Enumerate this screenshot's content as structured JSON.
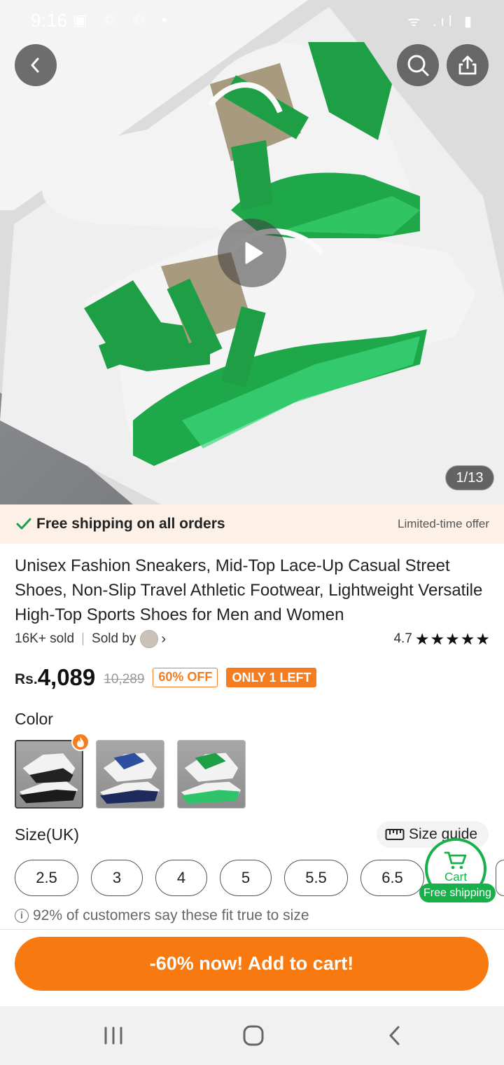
{
  "status_bar": {
    "time": "9:16",
    "left_icons": "▣ ♲ ♲ •",
    "right_icons": "ᯤ .ıl ▮"
  },
  "gallery": {
    "counter": "1/13"
  },
  "shipping_banner": {
    "text": "Free shipping on all orders",
    "offer": "Limited-time offer"
  },
  "product": {
    "title": "Unisex Fashion Sneakers, Mid-Top Lace-Up Casual Street Shoes, Non-Slip Travel Athletic Footwear, Lightweight Versatile High-Top Sports Shoes for Men and Women",
    "sold": "16K+ sold",
    "sold_by": "Sold by",
    "rating": "4.7",
    "stars": "★★★★★",
    "currency": "Rs.",
    "price": "4,089",
    "original_price": "10,289",
    "discount_badge": "60% OFF",
    "stock_badge": "ONLY 1 LEFT"
  },
  "color": {
    "label": "Color",
    "options": [
      "black-white",
      "blue-white",
      "green-white"
    ],
    "selected": 0
  },
  "size": {
    "label": "Size(UK)",
    "guide": "Size guide",
    "options": [
      "2.5",
      "3",
      "4",
      "5",
      "5.5",
      "6.5"
    ],
    "fit_note": "92% of customers say these fit true to size"
  },
  "cart_fab": {
    "label": "Cart",
    "tag": "Free shipping"
  },
  "cta": {
    "label": "-60% now! Add to cart!"
  },
  "colors": {
    "accent": "#f7790f",
    "green": "#18b04a",
    "banner": "#fdf0e6"
  }
}
